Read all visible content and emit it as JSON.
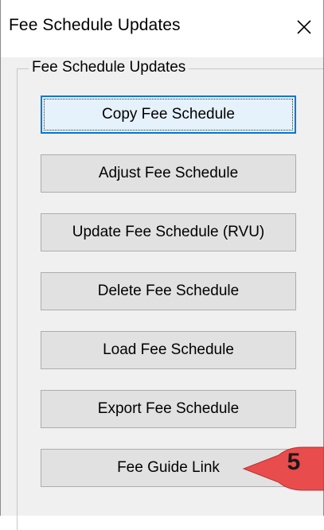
{
  "window": {
    "title": "Fee Schedule Updates",
    "close_icon": "close-icon"
  },
  "group": {
    "label": "Fee Schedule Updates"
  },
  "buttons": [
    {
      "label": "Copy Fee Schedule",
      "focused": true
    },
    {
      "label": "Adjust Fee Schedule",
      "focused": false
    },
    {
      "label": "Update Fee Schedule (RVU)",
      "focused": false
    },
    {
      "label": "Delete Fee Schedule",
      "focused": false
    },
    {
      "label": "Load Fee Schedule",
      "focused": false
    },
    {
      "label": "Export Fee Schedule",
      "focused": false
    },
    {
      "label": "Fee Guide Link",
      "focused": false
    }
  ],
  "callout": {
    "number": "5",
    "color": "#e84c4c"
  },
  "colors": {
    "focus_border": "#0078d7",
    "button_face": "#e1e1e1",
    "dialog_bg": "#f0f0f0"
  }
}
